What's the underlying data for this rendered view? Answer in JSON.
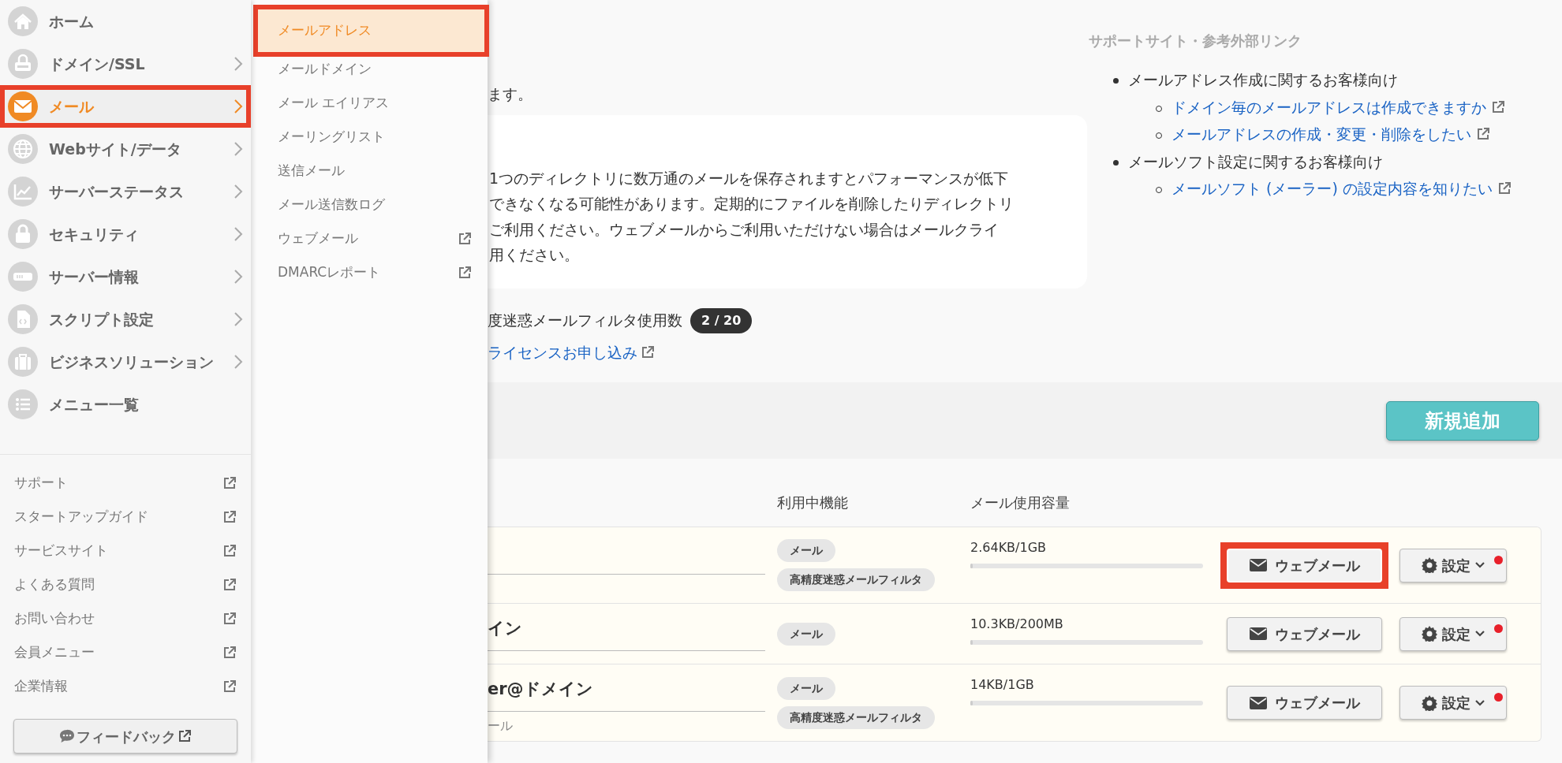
{
  "sidebar": {
    "items": [
      {
        "label": "ホーム",
        "selected": false,
        "annotated": false,
        "has_submenu": false
      },
      {
        "label": "ドメイン/SSL",
        "selected": false,
        "annotated": false,
        "has_submenu": true
      },
      {
        "label": "メール",
        "selected": true,
        "annotated": true,
        "has_submenu": true
      },
      {
        "label": "Webサイト/データ",
        "selected": false,
        "annotated": false,
        "has_submenu": true
      },
      {
        "label": "サーバーステータス",
        "selected": false,
        "annotated": false,
        "has_submenu": true
      },
      {
        "label": "セキュリティ",
        "selected": false,
        "annotated": false,
        "has_submenu": true
      },
      {
        "label": "サーバー情報",
        "selected": false,
        "annotated": false,
        "has_submenu": true
      },
      {
        "label": "スクリプト設定",
        "selected": false,
        "annotated": false,
        "has_submenu": true
      },
      {
        "label": "ビジネスソリューション",
        "selected": false,
        "annotated": false,
        "has_submenu": true
      },
      {
        "label": "メニュー一覧",
        "selected": false,
        "annotated": false,
        "has_submenu": false
      }
    ],
    "links": [
      {
        "label": "サポート"
      },
      {
        "label": "スタートアップガイド"
      },
      {
        "label": "サービスサイト"
      },
      {
        "label": "よくある質問"
      },
      {
        "label": "お問い合わせ"
      },
      {
        "label": "会員メニュー"
      },
      {
        "label": "企業情報"
      }
    ],
    "feedback_button": "フィードバック"
  },
  "submenu": {
    "items": [
      {
        "label": "メールアドレス",
        "selected": true,
        "annotated": true,
        "external": false
      },
      {
        "label": "メールドメイン",
        "selected": false,
        "annotated": false,
        "external": false
      },
      {
        "label": "メール エイリアス",
        "selected": false,
        "annotated": false,
        "external": false
      },
      {
        "label": "メーリングリスト",
        "selected": false,
        "annotated": false,
        "external": false
      },
      {
        "label": "送信メール",
        "selected": false,
        "annotated": false,
        "external": false
      },
      {
        "label": "メール送信数ログ",
        "selected": false,
        "annotated": false,
        "external": false
      },
      {
        "label": "ウェブメール",
        "selected": false,
        "annotated": false,
        "external": true
      },
      {
        "label": "DMARCレポート",
        "selected": false,
        "annotated": false,
        "external": true
      }
    ]
  },
  "intro_tail": "ます。",
  "notice_lines": [
    "1つのディレクトリに数万通のメールを保存されますとパフォーマンスが低下",
    "できなくなる可能性があります。定期的にファイルを削除したりディレクトリ",
    "ご利用ください。ウェブメールからご利用いただけない場合はメールクライ",
    "用ください。"
  ],
  "filter_usage": {
    "label": "度迷惑メールフィルタ使用数",
    "count": "2 / 20"
  },
  "license_link": "ライセンスお申し込み",
  "support": {
    "heading": "サポートサイト・参考外部リンク",
    "groups": [
      {
        "label": "メールアドレス作成に関するお客様向け",
        "links": [
          "ドメイン毎のメールアドレスは作成できますか",
          "メールアドレスの作成・変更・削除をしたい"
        ]
      },
      {
        "label": "メールソフト設定に関するお客様向け",
        "links": [
          "メールソフト (メーラー) の設定内容を知りたい"
        ]
      }
    ]
  },
  "add_button": "新規追加",
  "table": {
    "columns": [
      {
        "label": "利用中機能"
      },
      {
        "label": "メール使用容量"
      }
    ],
    "rows": [
      {
        "features": [
          "メール",
          "高精度迷惑メールフィルタ"
        ],
        "usage": "2.64KB/1GB",
        "level": 0.01,
        "webmail": {
          "label": "ウェブメール",
          "annotated": true
        },
        "settings": {
          "label": "設定",
          "notification": true
        }
      },
      {
        "name": "イン",
        "features": [
          "メール"
        ],
        "usage": "10.3KB/200MB",
        "level": 0.01,
        "webmail": {
          "label": "ウェブメール",
          "annotated": false
        },
        "settings": {
          "label": "設定",
          "notification": true
        }
      },
      {
        "name": "er@ドメイン",
        "sub": "ール",
        "features": [
          "メール",
          "高精度迷惑メールフィルタ"
        ],
        "usage": "14KB/1GB",
        "level": 0.01,
        "webmail": {
          "label": "ウェブメール",
          "annotated": false
        },
        "settings": {
          "label": "設定",
          "notification": true
        }
      }
    ]
  }
}
